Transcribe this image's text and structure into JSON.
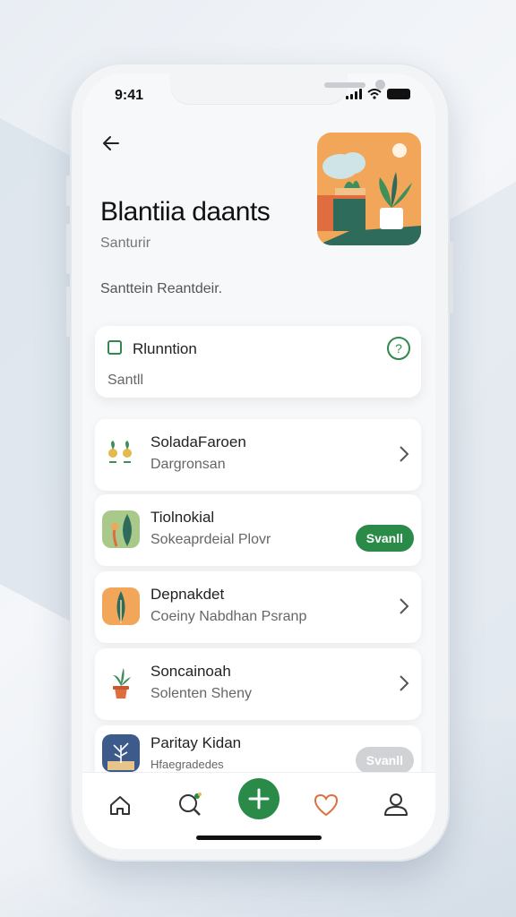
{
  "status": {
    "time": "9:41"
  },
  "hero": {
    "title": "Blantiia daants",
    "subtitle": "Santurir",
    "description": "Santtein Reantdeir."
  },
  "summary": {
    "title": "Rlunntion",
    "subtitle": "Santll"
  },
  "items": [
    {
      "title": "SoladaFaroen",
      "subtitle": "Dargronsan",
      "action": "chevron",
      "icon": "sprouts-icon"
    },
    {
      "title": "Tiolnokial",
      "subtitle": "Sokeaprdeial Plovr",
      "action": "pill",
      "pill_label": "Svanll",
      "icon": "leaf-plant-icon"
    },
    {
      "title": "Depnakdet",
      "subtitle": "Coeiny Nabdhan Psranp",
      "action": "chevron",
      "icon": "tall-plant-icon"
    },
    {
      "title": "Soncainoah",
      "subtitle": "Solenten Sheny",
      "action": "chevron",
      "icon": "potted-plant-icon"
    },
    {
      "title": "Paritay Kidan",
      "subtitle": "Hfaegradedes",
      "action": "pill-muted",
      "pill_label": "Svanll",
      "icon": "tree-icon"
    }
  ],
  "colors": {
    "accent": "#2a8a48",
    "orange": "#f2a65a",
    "teal": "#2f6b5a"
  },
  "tabs": [
    "home-icon",
    "search-icon",
    "add-icon",
    "heart-icon",
    "profile-icon"
  ]
}
